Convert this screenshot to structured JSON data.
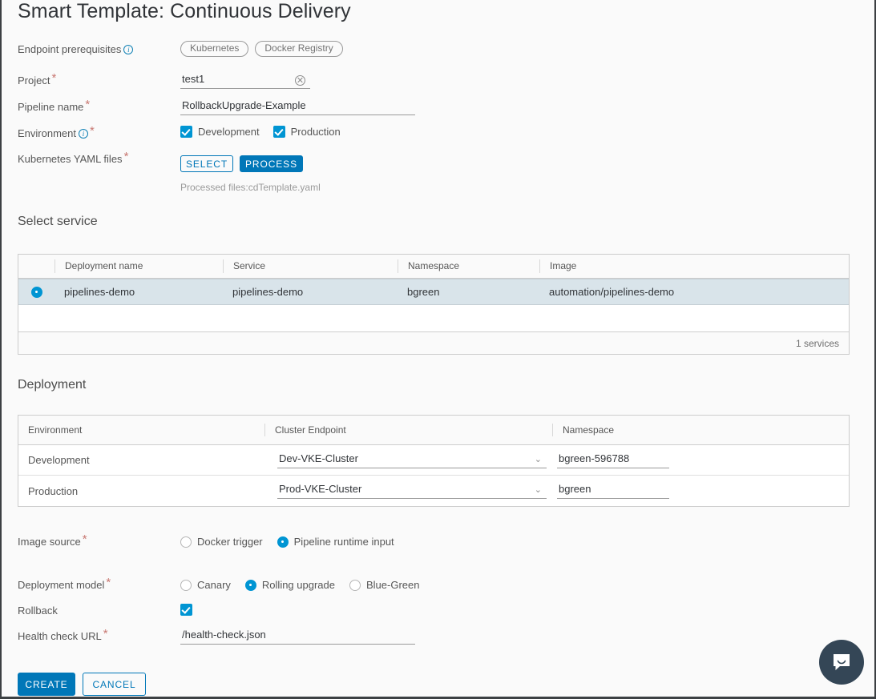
{
  "title": "Smart Template: Continuous Delivery",
  "form": {
    "endpoint_prereq": {
      "label": "Endpoint prerequisites",
      "info_icon": "info-icon",
      "chips": [
        "Kubernetes",
        "Docker Registry"
      ]
    },
    "project": {
      "label": "Project",
      "value": "test1",
      "placeholder": "",
      "clear_icon": "clear-icon"
    },
    "pipeline_name": {
      "label": "Pipeline name",
      "value": "RollbackUpgrade-Example",
      "placeholder": ""
    },
    "environment": {
      "label": "Environment",
      "info_icon": "info-icon",
      "options": [
        {
          "label": "Development",
          "checked": true
        },
        {
          "label": "Production",
          "checked": true
        }
      ]
    },
    "yaml_files": {
      "label": "Kubernetes YAML files",
      "select_label": "SELECT",
      "process_label": "PROCESS",
      "processed_text": "Processed files:cdTemplate.yaml"
    }
  },
  "select_service": {
    "heading": "Select service",
    "columns": [
      "Deployment name",
      "Service",
      "Namespace",
      "Image"
    ],
    "rows": [
      {
        "selected": true,
        "deployment_name": "pipelines-demo",
        "service": "pipelines-demo",
        "namespace": "bgreen",
        "image": "automation/pipelines-demo"
      }
    ],
    "footer": "1 services"
  },
  "deployment": {
    "heading": "Deployment",
    "columns": [
      "Environment",
      "Cluster Endpoint",
      "Namespace"
    ],
    "rows": [
      {
        "environment": "Development",
        "cluster_endpoint": "Dev-VKE-Cluster",
        "namespace": "bgreen-596788"
      },
      {
        "environment": "Production",
        "cluster_endpoint": "Prod-VKE-Cluster",
        "namespace": "bgreen"
      }
    ]
  },
  "image_source": {
    "label": "Image source",
    "options": [
      {
        "label": "Docker trigger",
        "selected": false
      },
      {
        "label": "Pipeline runtime input",
        "selected": true
      }
    ]
  },
  "deployment_model": {
    "label": "Deployment model",
    "options": [
      {
        "label": "Canary",
        "selected": false
      },
      {
        "label": "Rolling upgrade",
        "selected": true
      },
      {
        "label": "Blue-Green",
        "selected": false
      }
    ]
  },
  "rollback": {
    "label": "Rollback",
    "checked": true
  },
  "health_check": {
    "label": "Health check URL",
    "value": "/health-check.json",
    "placeholder": ""
  },
  "actions": {
    "create_label": "CREATE",
    "cancel_label": "CANCEL"
  },
  "chat": {
    "icon": "chat-bubble-icon"
  },
  "colors": {
    "accent": "#0077b8",
    "control_blue": "#0095d3",
    "required": "#c87872",
    "row_selected": "#d9e4ea",
    "chat_fab": "#344656"
  }
}
